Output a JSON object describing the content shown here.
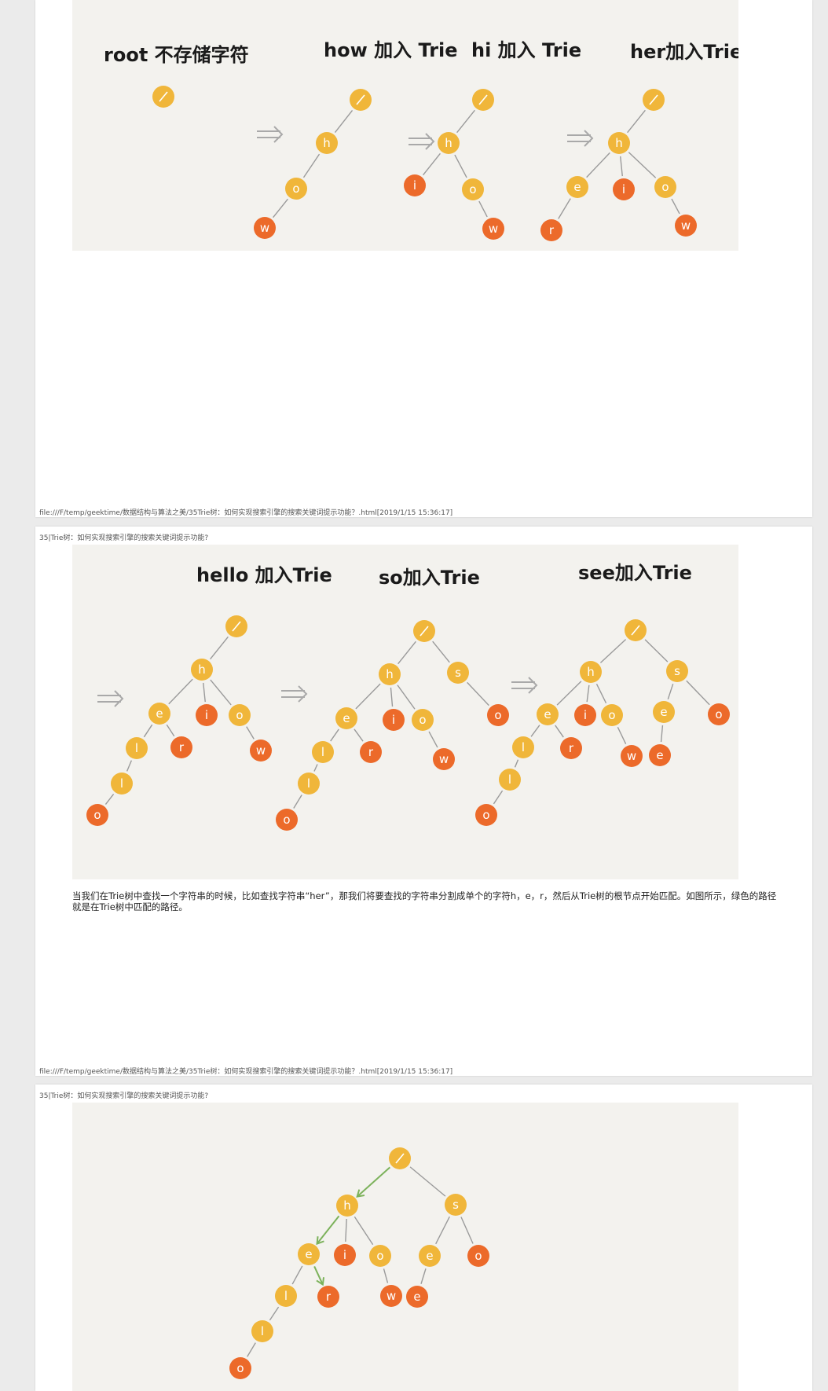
{
  "header_title": "35|Trie树：如何实现搜索引擎的搜索关键词提示功能?",
  "footer_text": "file:///F/temp/geektime/数据结构与算法之美/35Trie树：如何实现搜索引擎的搜索关键词提示功能？.html[2019/1/15 15:36:17]",
  "figure1": {
    "captions": [
      "root 不存储字符",
      "how 加入 Trie",
      "hi 加入 Trie",
      "her加入Trie"
    ],
    "root_symbol": "/"
  },
  "figure2": {
    "captions": [
      "hello 加入Trie",
      "so加入Trie",
      "see加入Trie"
    ]
  },
  "paragraph": "当我们在Trie树中查找一个字符串的时候，比如查找字符串“her”，那我们将要查找的字符串分割成单个的字符h，e，r，然后从Trie树的根节点开始匹配。如图所示，绿色的路径就是在Trie树中匹配的路径。",
  "colors": {
    "node_yellow": "#f0b63a",
    "node_orange": "#ec6a2a",
    "edge": "#9a9a9a",
    "arrow_green": "#7cb25b",
    "figure_bg": "#f3f2ee"
  },
  "icons": [
    "double-arrow-icon",
    "green-path-arrow-icon"
  ],
  "tree_figure1": [
    {
      "nodes": [
        {
          "id": "r",
          "label": "/",
          "c": "y"
        }
      ],
      "edges": []
    },
    {
      "nodes": [
        {
          "id": "r",
          "label": "/",
          "c": "y"
        },
        {
          "id": "h",
          "label": "h",
          "c": "y"
        },
        {
          "id": "o",
          "label": "o",
          "c": "y"
        },
        {
          "id": "w",
          "label": "w",
          "c": "o"
        }
      ],
      "edges": [
        [
          "r",
          "h"
        ],
        [
          "h",
          "o"
        ],
        [
          "o",
          "w"
        ]
      ]
    },
    {
      "nodes": [
        {
          "id": "r",
          "label": "/",
          "c": "y"
        },
        {
          "id": "h",
          "label": "h",
          "c": "y"
        },
        {
          "id": "i",
          "label": "i",
          "c": "o"
        },
        {
          "id": "o",
          "label": "o",
          "c": "y"
        },
        {
          "id": "w",
          "label": "w",
          "c": "o"
        }
      ],
      "edges": [
        [
          "r",
          "h"
        ],
        [
          "h",
          "i"
        ],
        [
          "h",
          "o"
        ],
        [
          "o",
          "w"
        ]
      ]
    },
    {
      "nodes": [
        {
          "id": "r",
          "label": "/",
          "c": "y"
        },
        {
          "id": "h",
          "label": "h",
          "c": "y"
        },
        {
          "id": "e",
          "label": "e",
          "c": "y"
        },
        {
          "id": "i",
          "label": "i",
          "c": "o"
        },
        {
          "id": "o",
          "label": "o",
          "c": "y"
        },
        {
          "id": "r2",
          "label": "r",
          "c": "o"
        },
        {
          "id": "w",
          "label": "w",
          "c": "o"
        }
      ],
      "edges": [
        [
          "r",
          "h"
        ],
        [
          "h",
          "e"
        ],
        [
          "h",
          "i"
        ],
        [
          "h",
          "o"
        ],
        [
          "e",
          "r2"
        ],
        [
          "o",
          "w"
        ]
      ]
    }
  ],
  "tree_figure2": [
    {
      "nodes": [
        {
          "id": "r",
          "label": "/",
          "c": "y"
        },
        {
          "id": "h",
          "label": "h",
          "c": "y"
        },
        {
          "id": "e",
          "label": "e",
          "c": "y"
        },
        {
          "id": "i",
          "label": "i",
          "c": "o"
        },
        {
          "id": "o",
          "label": "o",
          "c": "y"
        },
        {
          "id": "l1",
          "label": "l",
          "c": "y"
        },
        {
          "id": "r2",
          "label": "r",
          "c": "o"
        },
        {
          "id": "w",
          "label": "w",
          "c": "o"
        },
        {
          "id": "l2",
          "label": "l",
          "c": "y"
        },
        {
          "id": "o2",
          "label": "o",
          "c": "o"
        }
      ],
      "edges": [
        [
          "r",
          "h"
        ],
        [
          "h",
          "e"
        ],
        [
          "h",
          "i"
        ],
        [
          "h",
          "o"
        ],
        [
          "e",
          "l1"
        ],
        [
          "e",
          "r2"
        ],
        [
          "o",
          "w"
        ],
        [
          "l1",
          "l2"
        ],
        [
          "l2",
          "o2"
        ]
      ]
    },
    {
      "nodes": [
        {
          "id": "r",
          "label": "/",
          "c": "y"
        },
        {
          "id": "h",
          "label": "h",
          "c": "y"
        },
        {
          "id": "s",
          "label": "s",
          "c": "y"
        },
        {
          "id": "e",
          "label": "e",
          "c": "y"
        },
        {
          "id": "i",
          "label": "i",
          "c": "o"
        },
        {
          "id": "o",
          "label": "o",
          "c": "y"
        },
        {
          "id": "so",
          "label": "o",
          "c": "o"
        },
        {
          "id": "l1",
          "label": "l",
          "c": "y"
        },
        {
          "id": "r2",
          "label": "r",
          "c": "o"
        },
        {
          "id": "w",
          "label": "w",
          "c": "o"
        },
        {
          "id": "l2",
          "label": "l",
          "c": "y"
        },
        {
          "id": "o2",
          "label": "o",
          "c": "o"
        }
      ],
      "edges": [
        [
          "r",
          "h"
        ],
        [
          "r",
          "s"
        ],
        [
          "h",
          "e"
        ],
        [
          "h",
          "i"
        ],
        [
          "h",
          "o"
        ],
        [
          "s",
          "so"
        ],
        [
          "e",
          "l1"
        ],
        [
          "e",
          "r2"
        ],
        [
          "o",
          "w"
        ],
        [
          "l1",
          "l2"
        ],
        [
          "l2",
          "o2"
        ]
      ]
    },
    {
      "nodes": [
        {
          "id": "r",
          "label": "/",
          "c": "y"
        },
        {
          "id": "h",
          "label": "h",
          "c": "y"
        },
        {
          "id": "s",
          "label": "s",
          "c": "y"
        },
        {
          "id": "e",
          "label": "e",
          "c": "y"
        },
        {
          "id": "i",
          "label": "i",
          "c": "o"
        },
        {
          "id": "o",
          "label": "o",
          "c": "y"
        },
        {
          "id": "se",
          "label": "e",
          "c": "y"
        },
        {
          "id": "so",
          "label": "o",
          "c": "o"
        },
        {
          "id": "l1",
          "label": "l",
          "c": "y"
        },
        {
          "id": "r2",
          "label": "r",
          "c": "o"
        },
        {
          "id": "w",
          "label": "w",
          "c": "o"
        },
        {
          "id": "se2",
          "label": "e",
          "c": "o"
        },
        {
          "id": "l2",
          "label": "l",
          "c": "y"
        },
        {
          "id": "o2",
          "label": "o",
          "c": "o"
        }
      ],
      "edges": [
        [
          "r",
          "h"
        ],
        [
          "r",
          "s"
        ],
        [
          "h",
          "e"
        ],
        [
          "h",
          "i"
        ],
        [
          "h",
          "o"
        ],
        [
          "s",
          "se"
        ],
        [
          "s",
          "so"
        ],
        [
          "e",
          "l1"
        ],
        [
          "e",
          "r2"
        ],
        [
          "o",
          "w"
        ],
        [
          "se",
          "se2"
        ],
        [
          "l1",
          "l2"
        ],
        [
          "l2",
          "o2"
        ]
      ]
    }
  ],
  "tree_figure3": {
    "nodes": [
      {
        "id": "r",
        "label": "/",
        "c": "y"
      },
      {
        "id": "h",
        "label": "h",
        "c": "y"
      },
      {
        "id": "s",
        "label": "s",
        "c": "y"
      },
      {
        "id": "e",
        "label": "e",
        "c": "y"
      },
      {
        "id": "i",
        "label": "i",
        "c": "o"
      },
      {
        "id": "o",
        "label": "o",
        "c": "y"
      },
      {
        "id": "se",
        "label": "e",
        "c": "y"
      },
      {
        "id": "so",
        "label": "o",
        "c": "o"
      },
      {
        "id": "l1",
        "label": "l",
        "c": "y"
      },
      {
        "id": "r2",
        "label": "r",
        "c": "o"
      },
      {
        "id": "w",
        "label": "w",
        "c": "o"
      },
      {
        "id": "se2",
        "label": "e",
        "c": "o"
      },
      {
        "id": "l2",
        "label": "l",
        "c": "y"
      },
      {
        "id": "o2",
        "label": "o",
        "c": "o"
      }
    ],
    "edges": [
      [
        "r",
        "h"
      ],
      [
        "r",
        "s"
      ],
      [
        "h",
        "e"
      ],
      [
        "h",
        "i"
      ],
      [
        "h",
        "o"
      ],
      [
        "s",
        "se"
      ],
      [
        "s",
        "so"
      ],
      [
        "e",
        "l1"
      ],
      [
        "e",
        "r2"
      ],
      [
        "o",
        "w"
      ],
      [
        "se",
        "se2"
      ],
      [
        "l1",
        "l2"
      ],
      [
        "l2",
        "o2"
      ]
    ],
    "highlight_path": [
      "r",
      "h",
      "e",
      "r2"
    ]
  }
}
